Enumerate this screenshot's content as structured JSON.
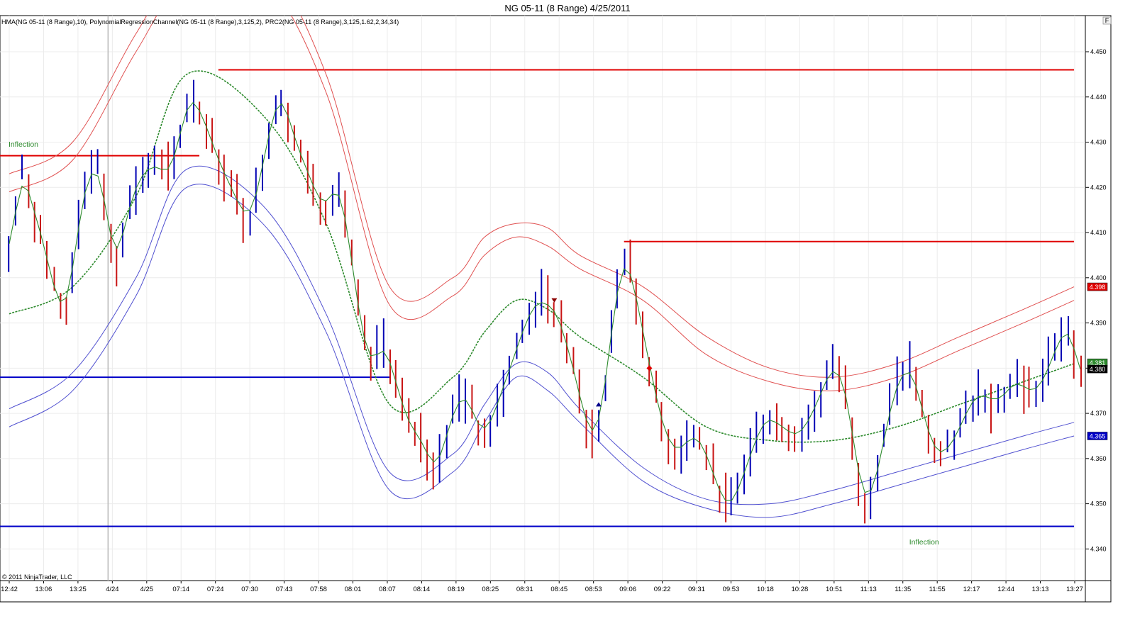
{
  "title": "NG 05-11 (8 Range)  4/25/2011",
  "indicator_label": "HMA(NG 05-11 (8 Range),10), PolynomialRegressionChannel(NG 05-11 (8 Range),3,125,2), PRC2(NG 05-11 (8 Range),3,125,1.62,2,34,34)",
  "copyright": "© 2011 NinjaTrader, LLC",
  "corner_button": "F",
  "colors": {
    "up_bar": "#0000b4",
    "down_bar": "#c81414",
    "hma": "#2e8b2e",
    "upper_channel": "#e05050",
    "lower_channel": "#5050d0",
    "resistance": "#e00000",
    "support": "#0000c8"
  },
  "chart_data": {
    "type": "line",
    "instrument": "NG 05-11 (8 Range)",
    "ylim": [
      4.333,
      4.458
    ],
    "y_ticks": [
      "4.340",
      "4.350",
      "4.360",
      "4.370",
      "4.380",
      "4.390",
      "4.400",
      "4.410",
      "4.420",
      "4.430",
      "4.440",
      "4.450"
    ],
    "x_ticks": [
      "12:42",
      "13:06",
      "13:25",
      "4/24",
      "4/25",
      "07:14",
      "07:24",
      "07:30",
      "07:43",
      "07:58",
      "08:01",
      "08:07",
      "08:14",
      "08:19",
      "08:25",
      "08:31",
      "08:45",
      "08:53",
      "09:06",
      "09:22",
      "09:31",
      "09:53",
      "10:18",
      "10:28",
      "10:51",
      "11:13",
      "11:35",
      "11:55",
      "12:17",
      "12:44",
      "13:13",
      "13:27"
    ],
    "session_break_tick": "4/24",
    "price_path": [
      4.405,
      4.415,
      4.423,
      4.42,
      4.414,
      4.41,
      4.404,
      4.398,
      4.394,
      4.393,
      4.402,
      4.412,
      4.42,
      4.424,
      4.424,
      4.418,
      4.408,
      4.404,
      4.41,
      4.416,
      4.42,
      4.423,
      4.424,
      4.425,
      4.424,
      4.423,
      4.426,
      4.432,
      4.438,
      4.44,
      4.437,
      4.434,
      4.43,
      4.426,
      4.423,
      4.42,
      4.417,
      4.414,
      4.414,
      4.418,
      4.425,
      4.432,
      4.438,
      4.44,
      4.436,
      4.431,
      4.427,
      4.424,
      4.42,
      4.417,
      4.416,
      4.419,
      4.42,
      4.414,
      4.404,
      4.394,
      4.386,
      4.381,
      4.383,
      4.385,
      4.382,
      4.377,
      4.372,
      4.368,
      4.366,
      4.364,
      4.361,
      4.358,
      4.36,
      4.365,
      4.37,
      4.373,
      4.374,
      4.371,
      4.367,
      4.366,
      4.368,
      4.372,
      4.376,
      4.38,
      4.384,
      4.388,
      4.392,
      4.394,
      4.395,
      4.394,
      4.393,
      4.39,
      4.385,
      4.38,
      4.374,
      4.368,
      4.365,
      4.367,
      4.376,
      4.388,
      4.398,
      4.404,
      4.402,
      4.395,
      4.388,
      4.381,
      4.374,
      4.368,
      4.364,
      4.362,
      4.362,
      4.364,
      4.365,
      4.364,
      4.361,
      4.357,
      4.353,
      4.35,
      4.35,
      4.353,
      4.357,
      4.361,
      4.365,
      4.368,
      4.369,
      4.368,
      4.367,
      4.366,
      4.365,
      4.366,
      4.368,
      4.371,
      4.374,
      4.378,
      4.38,
      4.379,
      4.375,
      4.366,
      4.356,
      4.351,
      4.352,
      4.357,
      4.364,
      4.371,
      4.376,
      4.379,
      4.38,
      4.377,
      4.371,
      4.366,
      4.362,
      4.361,
      4.362,
      4.364,
      4.367,
      4.37,
      4.373,
      4.374,
      4.374,
      4.373,
      4.373,
      4.374,
      4.376,
      4.377,
      4.376,
      4.375,
      4.375,
      4.377,
      4.38,
      4.384,
      4.387,
      4.389,
      4.385,
      4.378
    ],
    "series": [
      {
        "name": "HMA(NG 05-11 (8 Range),10)"
      },
      {
        "name": "PolynomialRegressionChannel(NG 05-11 (8 Range),3,125,2)",
        "x": [
          0,
          10,
          20,
          28,
          40,
          50,
          60,
          70,
          75,
          80,
          85,
          90,
          100,
          110,
          120,
          130,
          140,
          150,
          160,
          168
        ],
        "upper_outer": [
          4.423,
          4.43,
          4.454,
          4.47,
          4.47,
          4.445,
          4.398,
          4.4,
          4.409,
          4.412,
          4.411,
          4.405,
          4.398,
          4.387,
          4.38,
          4.378,
          4.381,
          4.387,
          4.393,
          4.398
        ],
        "upper_inner": [
          4.419,
          4.426,
          4.45,
          4.466,
          4.466,
          4.441,
          4.394,
          4.396,
          4.405,
          4.409,
          4.407,
          4.402,
          4.395,
          4.383,
          4.377,
          4.375,
          4.378,
          4.384,
          4.39,
          4.395
        ],
        "middle": [
          4.392,
          4.398,
          4.418,
          4.445,
          4.436,
          4.412,
          4.372,
          4.378,
          4.388,
          4.395,
          4.393,
          4.387,
          4.378,
          4.367,
          4.364,
          4.364,
          4.367,
          4.372,
          4.377,
          4.381
        ]
      },
      {
        "name": "PRC2(NG 05-11 (8 Range),3,125,1.62,2,34,34)",
        "x": [
          0,
          10,
          20,
          28,
          40,
          50,
          60,
          70,
          75,
          80,
          85,
          90,
          100,
          110,
          120,
          130,
          140,
          150,
          160,
          168
        ],
        "lower_outer": [
          4.367,
          4.375,
          4.396,
          4.42,
          4.412,
          4.388,
          4.353,
          4.357,
          4.368,
          4.378,
          4.375,
          4.368,
          4.355,
          4.349,
          4.347,
          4.35,
          4.354,
          4.358,
          4.362,
          4.365
        ],
        "lower_inner": [
          4.371,
          4.379,
          4.4,
          4.424,
          4.416,
          4.392,
          4.357,
          4.361,
          4.372,
          4.381,
          4.379,
          4.371,
          4.358,
          4.351,
          4.35,
          4.353,
          4.357,
          4.361,
          4.365,
          4.368
        ]
      }
    ],
    "horizontal_lines": [
      {
        "kind": "resistance",
        "y": 4.427,
        "x_start": 0,
        "x_end": 30
      },
      {
        "kind": "resistance",
        "y": 4.446,
        "x_start": 33,
        "x_end": 168
      },
      {
        "kind": "resistance",
        "y": 4.408,
        "x_start": 97,
        "x_end": 168
      },
      {
        "kind": "support",
        "y": 4.378,
        "x_start": 0,
        "x_end": 60
      },
      {
        "kind": "support",
        "y": 4.345,
        "x_start": 0,
        "x_end": 168
      }
    ],
    "markers": [
      {
        "kind": "down-arrow",
        "x": 86,
        "y": 4.395
      },
      {
        "kind": "up-arrow",
        "x": 93,
        "y": 4.372
      },
      {
        "kind": "diamond",
        "x": 101,
        "y": 4.38
      }
    ],
    "annotations": [
      {
        "text": "Inflection",
        "x": 0,
        "y": 4.429
      },
      {
        "text": "Inflection",
        "x": 142,
        "y": 4.341
      }
    ],
    "price_badges": [
      {
        "text": "4.398",
        "y": 4.398,
        "bg": "#e00000",
        "fg": "#ffffff"
      },
      {
        "text": "4.381",
        "y": 4.3812,
        "bg": "#2e8b2e",
        "fg": "#ffffff"
      },
      {
        "text": "4.380",
        "y": 4.3798,
        "bg": "#000000",
        "fg": "#ffffff"
      },
      {
        "text": "4.365",
        "y": 4.365,
        "bg": "#0000c8",
        "fg": "#ffffff"
      }
    ]
  }
}
